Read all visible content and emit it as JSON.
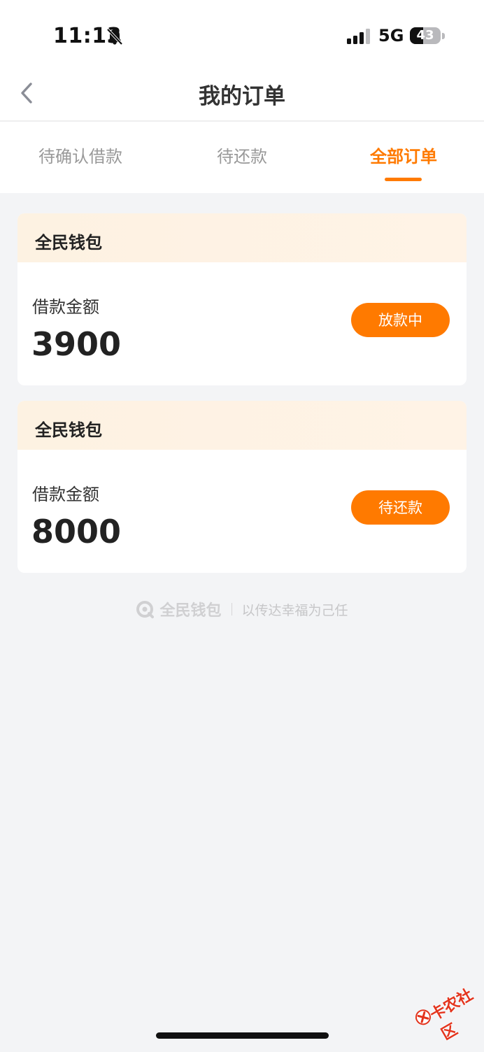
{
  "status_bar": {
    "time": "11:13",
    "network": "5G",
    "battery": "43",
    "battery_level": 0.43
  },
  "nav": {
    "title": "我的订单"
  },
  "tabs": [
    {
      "label": "待确认借款",
      "active": false
    },
    {
      "label": "待还款",
      "active": false
    },
    {
      "label": "全部订单",
      "active": true
    }
  ],
  "orders": [
    {
      "lender": "全民钱包",
      "amount_label": "借款金额",
      "amount": "3900",
      "status": "放款中"
    },
    {
      "lender": "全民钱包",
      "amount_label": "借款金额",
      "amount": "8000",
      "status": "待还款"
    }
  ],
  "footer": {
    "brand": "全民钱包",
    "slogan": "以传达幸福为己任"
  },
  "watermark": {
    "text": "卡农社区"
  },
  "colors": {
    "accent": "#ff7a00",
    "background": "#f3f4f6",
    "card_header": "#fdf2e2"
  }
}
